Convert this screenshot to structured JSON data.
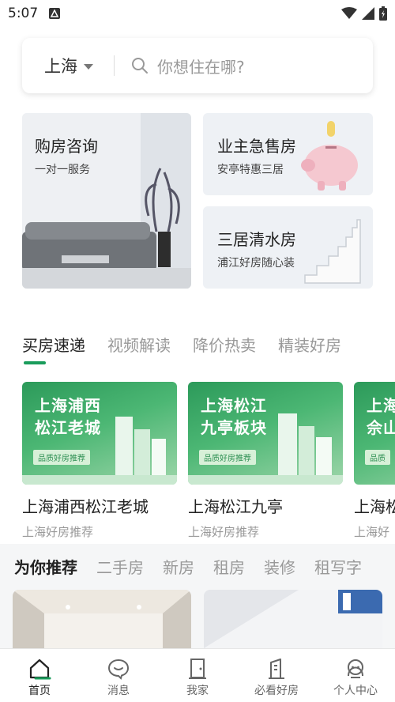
{
  "status_bar": {
    "time": "5:07"
  },
  "search": {
    "city": "上海",
    "placeholder": "你想住在哪?"
  },
  "promos": [
    {
      "title": "购房咨询",
      "subtitle": "一对一服务"
    },
    {
      "title": "业主急售房",
      "subtitle": "安亭特惠三居"
    },
    {
      "title": "三居清水房",
      "subtitle": "浦江好房随心装"
    }
  ],
  "feed_tabs": [
    "买房速递",
    "视频解读",
    "降价热卖",
    "精装好房"
  ],
  "feed_cards": [
    {
      "banner_line1": "上海浦西",
      "banner_line2": "松江老城",
      "tag": "品质好房推荐",
      "title": "上海浦西松江老城",
      "subtitle": "上海好房推荐"
    },
    {
      "banner_line1": "上海松江",
      "banner_line2": "九亭板块",
      "tag": "品质好房推荐",
      "title": "上海松江九亭",
      "subtitle": "上海好房推荐"
    },
    {
      "banner_line1": "上海",
      "banner_line2": "佘山",
      "tag": "品质",
      "title": "上海松",
      "subtitle": "上海好"
    }
  ],
  "recommend_tabs": [
    "为你推荐",
    "二手房",
    "新房",
    "租房",
    "装修",
    "租写字"
  ],
  "bottom_nav": [
    "首页",
    "消息",
    "我家",
    "必看好房",
    "个人中心"
  ],
  "colors": {
    "accent": "#1a9c5b",
    "banner_green": "#2c9a5a"
  }
}
